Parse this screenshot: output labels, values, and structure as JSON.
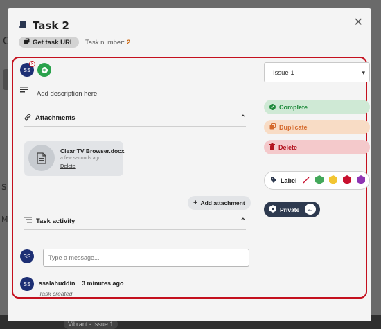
{
  "modal": {
    "title": "Task 2",
    "get_url_label": "Get task URL",
    "task_number_label": "Task number:",
    "task_number": "2"
  },
  "assignees": {
    "initials": "SS"
  },
  "description": {
    "placeholder": "Add description here"
  },
  "attachments": {
    "heading": "Attachments",
    "file_name": "Clear TV Browser.docx",
    "file_time": "a few seconds ago",
    "delete_label": "Delete",
    "add_label": "Add attachment"
  },
  "activity": {
    "heading": "Task activity",
    "input_initials": "SS",
    "input_placeholder": "Type a message...",
    "entry_initials": "SS",
    "entry_user": "ssalahuddin",
    "entry_time": "3 minutes ago",
    "entry_text": "Task created"
  },
  "sidebar": {
    "issue_select": "Issue 1",
    "complete_label": "Complete",
    "duplicate_label": "Duplicate",
    "delete_label": "Delete",
    "label_heading": "Label",
    "private_label": "Private"
  },
  "colors": {
    "label_green": "#43a85a",
    "label_yellow": "#f2c531",
    "label_red": "#c8102e",
    "label_purple": "#8e35b3"
  },
  "background": {
    "chip_text": "Vibrant - Issue 1"
  }
}
